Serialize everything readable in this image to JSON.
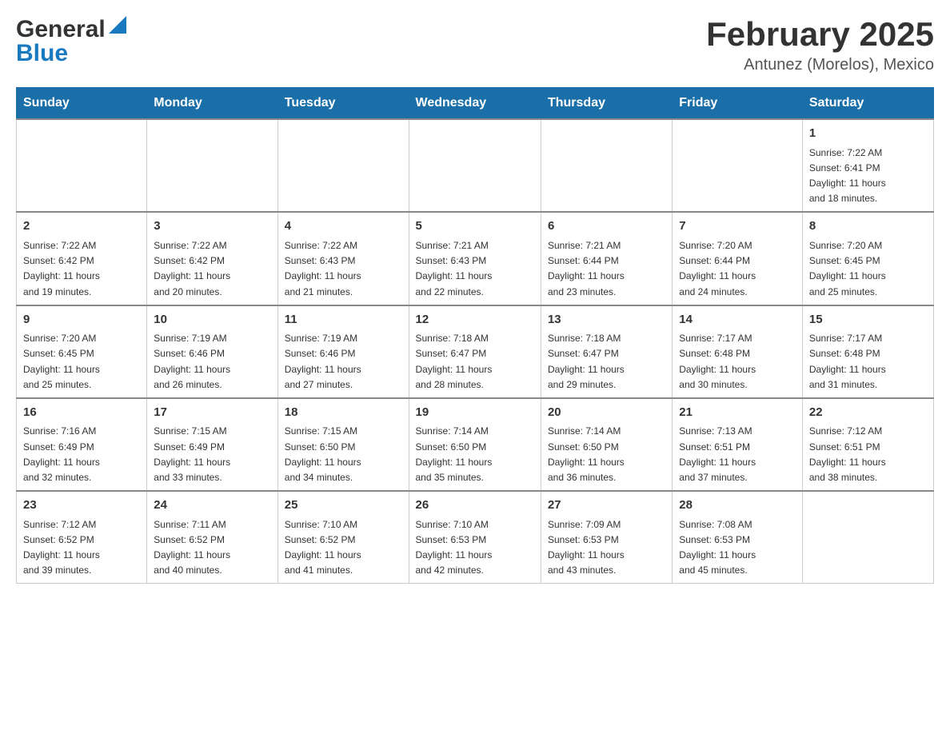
{
  "logo": {
    "general": "General",
    "blue": "Blue"
  },
  "title": "February 2025",
  "location": "Antunez (Morelos), Mexico",
  "days_of_week": [
    "Sunday",
    "Monday",
    "Tuesday",
    "Wednesday",
    "Thursday",
    "Friday",
    "Saturday"
  ],
  "weeks": [
    {
      "cells": [
        {
          "day": "",
          "info": ""
        },
        {
          "day": "",
          "info": ""
        },
        {
          "day": "",
          "info": ""
        },
        {
          "day": "",
          "info": ""
        },
        {
          "day": "",
          "info": ""
        },
        {
          "day": "",
          "info": ""
        },
        {
          "day": "1",
          "info": "Sunrise: 7:22 AM\nSunset: 6:41 PM\nDaylight: 11 hours\nand 18 minutes."
        }
      ]
    },
    {
      "cells": [
        {
          "day": "2",
          "info": "Sunrise: 7:22 AM\nSunset: 6:42 PM\nDaylight: 11 hours\nand 19 minutes."
        },
        {
          "day": "3",
          "info": "Sunrise: 7:22 AM\nSunset: 6:42 PM\nDaylight: 11 hours\nand 20 minutes."
        },
        {
          "day": "4",
          "info": "Sunrise: 7:22 AM\nSunset: 6:43 PM\nDaylight: 11 hours\nand 21 minutes."
        },
        {
          "day": "5",
          "info": "Sunrise: 7:21 AM\nSunset: 6:43 PM\nDaylight: 11 hours\nand 22 minutes."
        },
        {
          "day": "6",
          "info": "Sunrise: 7:21 AM\nSunset: 6:44 PM\nDaylight: 11 hours\nand 23 minutes."
        },
        {
          "day": "7",
          "info": "Sunrise: 7:20 AM\nSunset: 6:44 PM\nDaylight: 11 hours\nand 24 minutes."
        },
        {
          "day": "8",
          "info": "Sunrise: 7:20 AM\nSunset: 6:45 PM\nDaylight: 11 hours\nand 25 minutes."
        }
      ]
    },
    {
      "cells": [
        {
          "day": "9",
          "info": "Sunrise: 7:20 AM\nSunset: 6:45 PM\nDaylight: 11 hours\nand 25 minutes."
        },
        {
          "day": "10",
          "info": "Sunrise: 7:19 AM\nSunset: 6:46 PM\nDaylight: 11 hours\nand 26 minutes."
        },
        {
          "day": "11",
          "info": "Sunrise: 7:19 AM\nSunset: 6:46 PM\nDaylight: 11 hours\nand 27 minutes."
        },
        {
          "day": "12",
          "info": "Sunrise: 7:18 AM\nSunset: 6:47 PM\nDaylight: 11 hours\nand 28 minutes."
        },
        {
          "day": "13",
          "info": "Sunrise: 7:18 AM\nSunset: 6:47 PM\nDaylight: 11 hours\nand 29 minutes."
        },
        {
          "day": "14",
          "info": "Sunrise: 7:17 AM\nSunset: 6:48 PM\nDaylight: 11 hours\nand 30 minutes."
        },
        {
          "day": "15",
          "info": "Sunrise: 7:17 AM\nSunset: 6:48 PM\nDaylight: 11 hours\nand 31 minutes."
        }
      ]
    },
    {
      "cells": [
        {
          "day": "16",
          "info": "Sunrise: 7:16 AM\nSunset: 6:49 PM\nDaylight: 11 hours\nand 32 minutes."
        },
        {
          "day": "17",
          "info": "Sunrise: 7:15 AM\nSunset: 6:49 PM\nDaylight: 11 hours\nand 33 minutes."
        },
        {
          "day": "18",
          "info": "Sunrise: 7:15 AM\nSunset: 6:50 PM\nDaylight: 11 hours\nand 34 minutes."
        },
        {
          "day": "19",
          "info": "Sunrise: 7:14 AM\nSunset: 6:50 PM\nDaylight: 11 hours\nand 35 minutes."
        },
        {
          "day": "20",
          "info": "Sunrise: 7:14 AM\nSunset: 6:50 PM\nDaylight: 11 hours\nand 36 minutes."
        },
        {
          "day": "21",
          "info": "Sunrise: 7:13 AM\nSunset: 6:51 PM\nDaylight: 11 hours\nand 37 minutes."
        },
        {
          "day": "22",
          "info": "Sunrise: 7:12 AM\nSunset: 6:51 PM\nDaylight: 11 hours\nand 38 minutes."
        }
      ]
    },
    {
      "cells": [
        {
          "day": "23",
          "info": "Sunrise: 7:12 AM\nSunset: 6:52 PM\nDaylight: 11 hours\nand 39 minutes."
        },
        {
          "day": "24",
          "info": "Sunrise: 7:11 AM\nSunset: 6:52 PM\nDaylight: 11 hours\nand 40 minutes."
        },
        {
          "day": "25",
          "info": "Sunrise: 7:10 AM\nSunset: 6:52 PM\nDaylight: 11 hours\nand 41 minutes."
        },
        {
          "day": "26",
          "info": "Sunrise: 7:10 AM\nSunset: 6:53 PM\nDaylight: 11 hours\nand 42 minutes."
        },
        {
          "day": "27",
          "info": "Sunrise: 7:09 AM\nSunset: 6:53 PM\nDaylight: 11 hours\nand 43 minutes."
        },
        {
          "day": "28",
          "info": "Sunrise: 7:08 AM\nSunset: 6:53 PM\nDaylight: 11 hours\nand 45 minutes."
        },
        {
          "day": "",
          "info": ""
        }
      ]
    }
  ]
}
